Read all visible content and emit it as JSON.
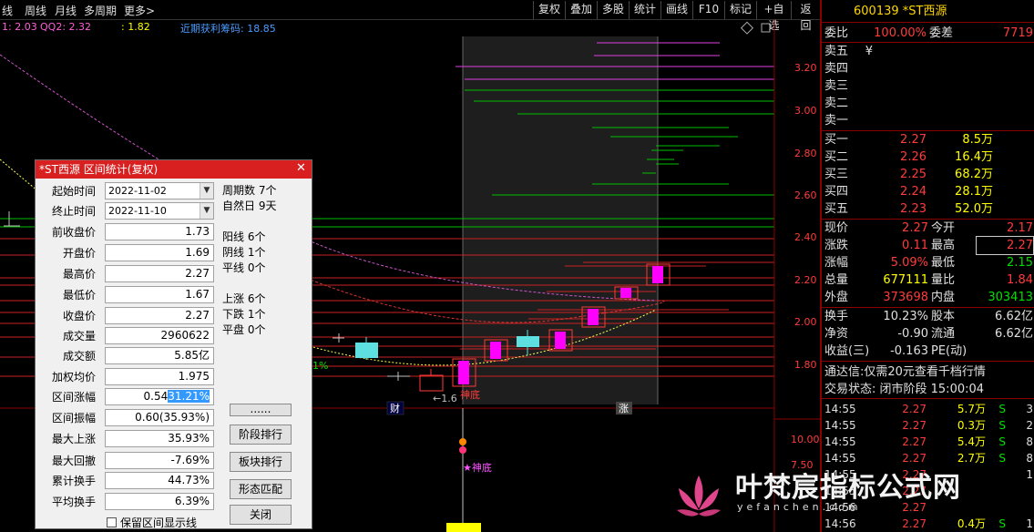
{
  "toolbar": {
    "periods": [
      "线",
      "周线",
      "月线",
      "多周期",
      "更多>"
    ],
    "buttons": [
      "复权",
      "叠加",
      "多股",
      "统计",
      "画线",
      "F10",
      "标记",
      "+自选",
      "返回"
    ]
  },
  "indicators": {
    "ind1": "1: 2.03",
    "ind2": "QQ2: 2.32",
    "ind3": ": 1.82",
    "ind4": "近期获利筹码: 18.85"
  },
  "price_axis": [
    "3.20",
    "3.00",
    "2.80",
    "2.60",
    "2.40",
    "2.20",
    "2.00",
    "1.80"
  ],
  "vol_axis": [
    "10.00",
    "7.50"
  ],
  "chart_labels": {
    "low_marker": "←1.6",
    "shendi1": "神底",
    "shendi2": "★神底",
    "cai": "财",
    "zhang": "涨",
    "pct_left": "1%"
  },
  "dialog": {
    "title": "*ST西源 区间统计(复权)",
    "start_label": "起始时间",
    "start_value": "2022-11-02",
    "end_label": "终止时间",
    "end_value": "2022-11-10",
    "fields": [
      {
        "label": "前收盘价",
        "value": "1.73"
      },
      {
        "label": "开盘价",
        "value": "1.69"
      },
      {
        "label": "最高价",
        "value": "2.27"
      },
      {
        "label": "最低价",
        "value": "1.67"
      },
      {
        "label": "收盘价",
        "value": "2.27"
      },
      {
        "label": "成交量",
        "value": "2960622"
      },
      {
        "label": "成交额",
        "value": "5.85亿"
      },
      {
        "label": "加权均价",
        "value": "1.975"
      }
    ],
    "range_change_label": "区间涨幅",
    "range_change_a": "0.54",
    "range_change_b": "31.21%",
    "fields2": [
      {
        "label": "区间振幅",
        "value": "0.60(35.93%)"
      },
      {
        "label": "最大上涨",
        "value": "35.93%"
      },
      {
        "label": "最大回撤",
        "value": "-7.69%"
      },
      {
        "label": "累计换手",
        "value": "44.73%"
      },
      {
        "label": "平均换手",
        "value": "6.39%"
      }
    ],
    "stats": [
      "周期数 7个",
      "自然日 9天",
      "阳线 6个",
      "阴线 1个",
      "平线 0个",
      "上涨 6个",
      "下跌 1个",
      "平盘 0个"
    ],
    "buttons": [
      "......",
      "阶段排行",
      "板块排行",
      "形态匹配",
      "关闭"
    ],
    "keep_label": "保留区间显示线"
  },
  "quote": {
    "code_name": "600139 *ST西源",
    "weibi_label": "委比",
    "weibi": "100.00%",
    "weicha_label": "委差",
    "weicha": "7719",
    "sell": [
      {
        "label": "卖五",
        "price": "¥",
        "vol": ""
      },
      {
        "label": "卖四",
        "price": "",
        "vol": ""
      },
      {
        "label": "卖三",
        "price": "",
        "vol": ""
      },
      {
        "label": "卖二",
        "price": "",
        "vol": ""
      },
      {
        "label": "卖一",
        "price": "",
        "vol": ""
      }
    ],
    "buy": [
      {
        "label": "买一",
        "price": "2.27",
        "vol": "8.5万"
      },
      {
        "label": "买二",
        "price": "2.26",
        "vol": "16.4万"
      },
      {
        "label": "买三",
        "price": "2.25",
        "vol": "68.2万"
      },
      {
        "label": "买四",
        "price": "2.24",
        "vol": "28.1万"
      },
      {
        "label": "买五",
        "price": "2.23",
        "vol": "52.0万"
      }
    ],
    "stats": [
      {
        "l1": "现价",
        "v1": "2.27",
        "c1": "red",
        "l2": "今开",
        "v2": "2.17",
        "c2": "red"
      },
      {
        "l1": "涨跌",
        "v1": "0.11",
        "c1": "red",
        "l2": "最高",
        "v2": "2.27",
        "c2": "red"
      },
      {
        "l1": "涨幅",
        "v1": "5.09%",
        "c1": "red",
        "l2": "最低",
        "v2": "2.15",
        "c2": "grn"
      },
      {
        "l1": "总量",
        "v1": "677111",
        "c1": "yel",
        "l2": "量比",
        "v2": "1.84",
        "c2": "red"
      },
      {
        "l1": "外盘",
        "v1": "373698",
        "c1": "red",
        "l2": "内盘",
        "v2": "303413",
        "c2": "grn"
      }
    ],
    "stats2": [
      {
        "l1": "换手",
        "v1": "10.23%",
        "c1": "wht",
        "l2": "股本",
        "v2": "6.62亿",
        "c2": "wht"
      },
      {
        "l1": "净资",
        "v1": "-0.90",
        "c1": "wht",
        "l2": "流通",
        "v2": "6.62亿",
        "c2": "wht"
      },
      {
        "l1": "收益(三)",
        "v1": "-0.163",
        "c1": "wht",
        "l2": "PE(动)",
        "v2": "",
        "c2": "wht"
      }
    ],
    "notice": "通达信:仅需20元查看千档行情",
    "status": "交易状态: 闭市阶段 15:00:04",
    "ticks": [
      {
        "t": "14:55",
        "p": "2.27",
        "v": "5.7万",
        "s": "S",
        "n": "3"
      },
      {
        "t": "14:55",
        "p": "2.27",
        "v": "0.3万",
        "s": "S",
        "n": "2"
      },
      {
        "t": "14:55",
        "p": "2.27",
        "v": "5.4万",
        "s": "S",
        "n": "8"
      },
      {
        "t": "14:55",
        "p": "2.27",
        "v": "2.7万",
        "s": "S",
        "n": "8"
      },
      {
        "t": "14:55",
        "p": "2.27",
        "v": "",
        "s": "",
        "n": "1"
      },
      {
        "t": "14:55",
        "p": "2.27",
        "v": "",
        "s": "",
        "n": ""
      },
      {
        "t": "14:56",
        "p": "2.27",
        "v": "",
        "s": "",
        "n": ""
      },
      {
        "t": "14:56",
        "p": "2.27",
        "v": "0.4万",
        "s": "S",
        "n": "1"
      }
    ]
  },
  "watermark": {
    "text": "叶梵宸指标公式网",
    "url": "yefanchen.com"
  },
  "colors": {
    "up": "#ff3b3b",
    "down": "#00e000",
    "magenta": "#ff00ff",
    "cyan": "#5fe0e0"
  }
}
